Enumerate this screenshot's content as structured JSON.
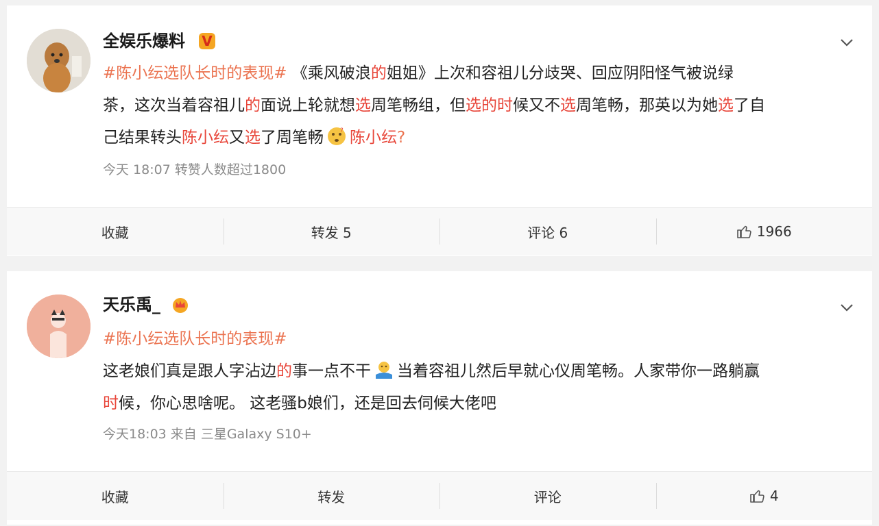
{
  "posts": [
    {
      "username": "全娱乐爆料",
      "badge_text": "V",
      "content_segments": {
        "l1": [
          "#陈小纭选队长时的表现#",
          " 《乘风破浪",
          "的",
          "姐姐》上次和容祖儿分歧哭、回应阴阳怪气被说绿"
        ],
        "l2": [
          "茶，这次当着容祖儿",
          "的",
          "面说上轮就想",
          "选",
          "周笔畅组，但",
          "选的时",
          "候又不",
          "选",
          "周笔畅，那英以为她",
          "选",
          "了自"
        ],
        "l3": [
          "己结果转头",
          "陈小纭",
          "又",
          "选",
          "了周笔畅",
          "陈小纭",
          "?"
        ]
      },
      "meta": "今天 18:07  转赞人数超过1800",
      "actions": {
        "favorite": "收藏",
        "repost": "转发 5",
        "comment": "评论 6",
        "like": "1966"
      }
    },
    {
      "username": "天乐禹_",
      "content_segments": {
        "l1": [
          "#陈小纭选队长时的表现#"
        ],
        "l2": [
          "这老娘们真是跟人字沾边",
          "的",
          "事一点不干",
          "当着容祖儿然后早就心仪周笔畅。人家带你一路躺赢"
        ],
        "l3": [
          "时",
          "候，你心思啥呢。 这老骚b娘们，还是回去伺候大佬吧"
        ]
      },
      "meta": "今天18:03  来自 三星Galaxy S10+",
      "actions": {
        "favorite": "收藏",
        "repost": "转发",
        "comment": "评论",
        "like": "4"
      }
    }
  ],
  "icons": {
    "chevron": "chevron-down-icon",
    "like": "thumbs-up-icon",
    "verified": "verified-v-icon",
    "crown": "crown-icon",
    "emoji1": "thinking-face-emoji",
    "emoji2": "shrug-emoji"
  },
  "colors": {
    "topic": "#eb7350",
    "highlight": "#e8463a",
    "meta": "#8a8a8a",
    "badge": "#f5a623"
  }
}
